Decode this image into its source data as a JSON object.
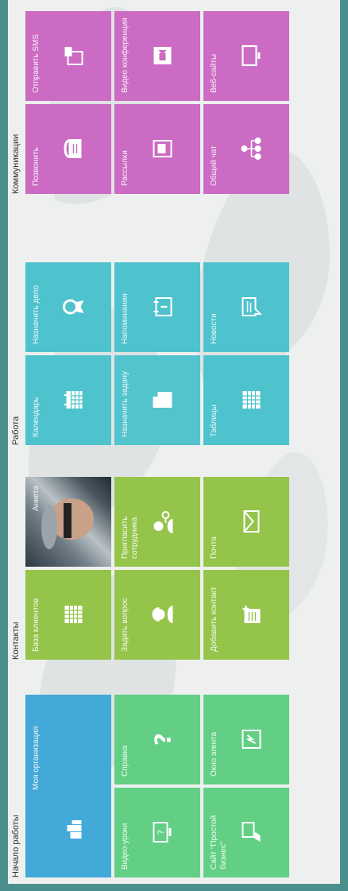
{
  "groups": {
    "start": "Начало работы",
    "contacts": "Контакты",
    "work": "Работа",
    "comms": "Коммуникации"
  },
  "tiles": {
    "my_org": "Моя организация",
    "video_lessons": "Видео-уроки",
    "help": "Справка",
    "site": "Сайт \"Простой бизнес\"",
    "agent_window": "Окно агента",
    "client_base": "База клиентов",
    "profile": "Анкета",
    "ask_question": "Задать вопрос",
    "invite_employee": "Пригласить сотрудника",
    "add_contact": "Добавить контакт",
    "mail": "Почта",
    "calendar": "Календарь",
    "assign_task": "Назначить дело",
    "set_task": "Назначить задачу",
    "reminders": "Напоминания",
    "tables": "Таблицы",
    "news": "Новости",
    "call": "Позвонить",
    "send_sms": "Отправить SMS",
    "mailings": "Рассылки",
    "video_conf": "Видео конференция",
    "common_chat": "Общий чат",
    "websites": "Веб-сайты"
  },
  "colors": {
    "start_green": "#62cf84",
    "org_blue": "#43a9d8",
    "contacts_lime": "#95c44b",
    "work_teal": "#4ec3cd",
    "comms_pink": "#cb6bc3"
  }
}
